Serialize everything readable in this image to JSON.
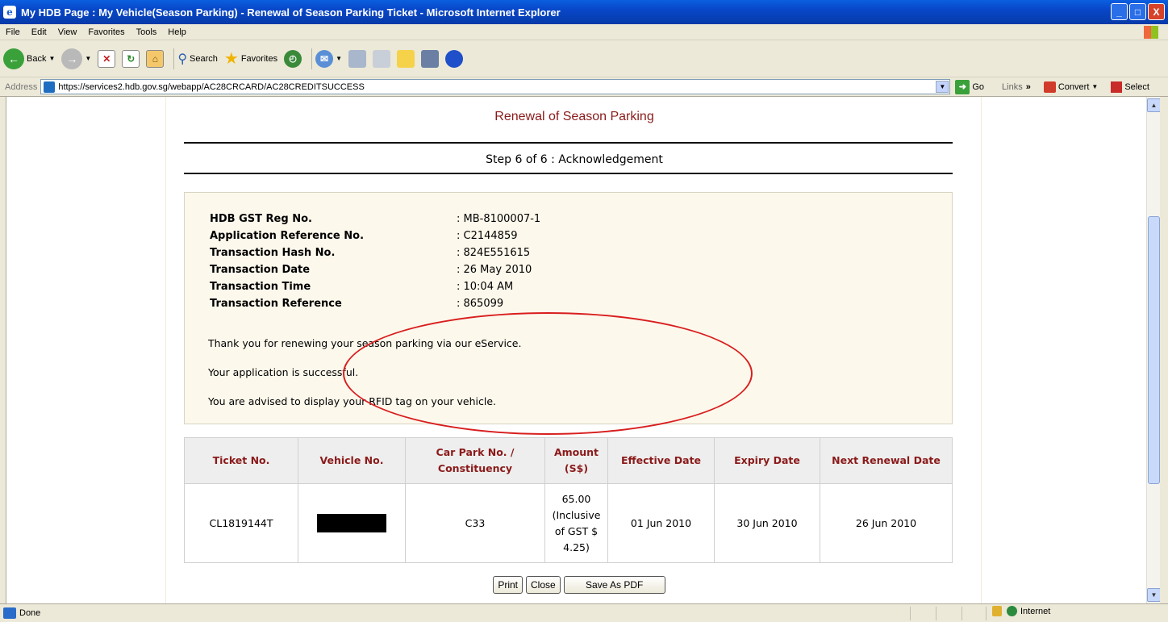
{
  "window": {
    "title": "My HDB Page : My Vehicle(Season Parking) - Renewal of Season Parking Ticket - Microsoft Internet Explorer",
    "controls": [
      "_",
      "□",
      "X"
    ]
  },
  "menu": [
    "File",
    "Edit",
    "View",
    "Favorites",
    "Tools",
    "Help"
  ],
  "toolbar": {
    "back_label": "Back",
    "search_label": "Search",
    "favorites_label": "Favorites"
  },
  "addressbar": {
    "label": "Address",
    "url": "https://services2.hdb.gov.sg/webapp/AC28CRCARD/AC28CREDITSUCCESS",
    "go_label": "Go",
    "links_label": "Links",
    "links_more": "»",
    "convert_label": "Convert",
    "select_label": "Select"
  },
  "page": {
    "heading": "Renewal of Season Parking",
    "step": "Step 6 of 6 : Acknowledgement",
    "info": [
      {
        "label": "HDB GST Reg No.",
        "value": ": MB-8100007-1"
      },
      {
        "label": "Application Reference No.",
        "value": ": C2144859"
      },
      {
        "label": "Transaction Hash No.",
        "value": ": 824E551615"
      },
      {
        "label": "Transaction Date",
        "value": ": 26 May 2010"
      },
      {
        "label": "Transaction Time",
        "value": ": 10:04 AM"
      },
      {
        "label": "Transaction Reference",
        "value": ": 865099"
      }
    ],
    "messages": [
      "Thank you for renewing your season parking via our eService.",
      "Your application is successful.",
      "You are advised to display your RFID tag on your vehicle."
    ],
    "table": {
      "headers": [
        "Ticket No.",
        "Vehicle No.",
        "Car Park No. / Constituency",
        "Amount (S$)",
        "Effective Date",
        "Expiry Date",
        "Next Renewal Date"
      ],
      "row": {
        "ticket": "CL1819144T",
        "vehicle": "",
        "carpark": "C33",
        "amount": "65.00 (Inclusive of GST $ 4.25)",
        "effective": "01 Jun 2010",
        "expiry": "30 Jun 2010",
        "renewal": "26 Jun 2010"
      }
    },
    "buttons": {
      "print": "Print",
      "close": "Close",
      "pdf": "Save As PDF"
    }
  },
  "status": {
    "text": "Done",
    "zone": "Internet"
  }
}
